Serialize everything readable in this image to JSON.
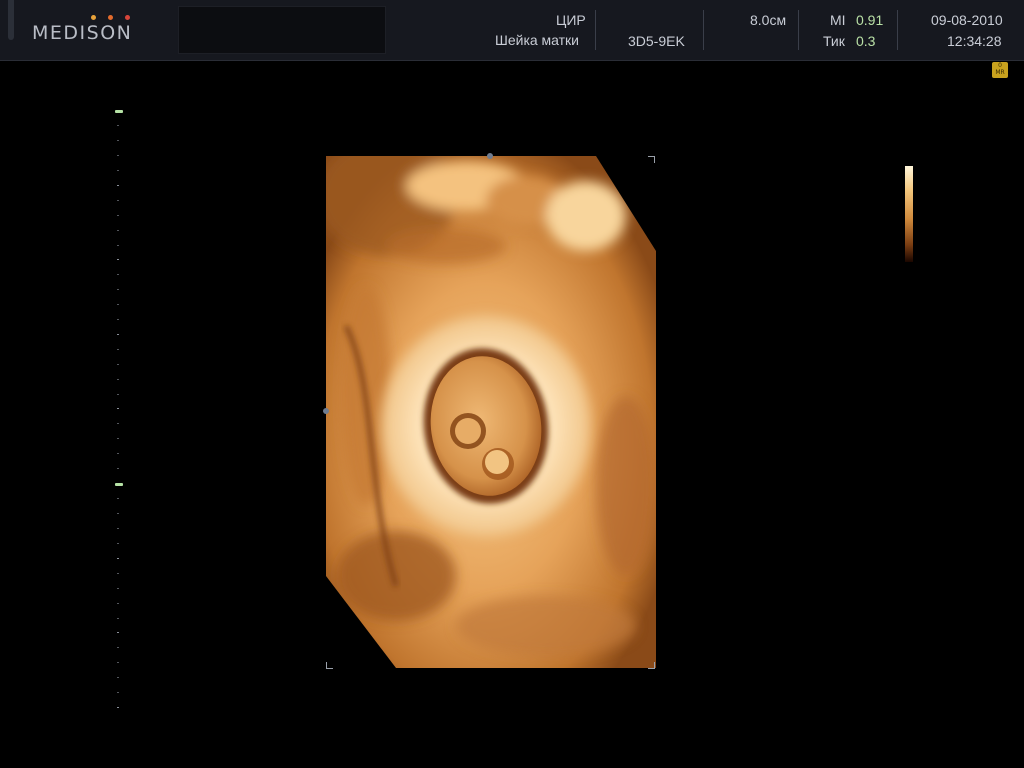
{
  "header": {
    "brand": "MEDISON",
    "mode_label": "ЦИР",
    "organ_label": "Шейка матки",
    "probe": "3D5-9EK",
    "depth": "8.0см",
    "mi_label": "MI",
    "mi_value": "0.91",
    "tic_label": "Тик",
    "tic_value": "0.3",
    "date": "09-08-2010",
    "time": "12:34:28"
  },
  "badges": {
    "mr_icon": "0\nMR"
  },
  "colors": {
    "header_bg": "#16181f",
    "value_green": "#b9e0a6",
    "logo_dot_1": "#e8a23a",
    "logo_dot_2": "#e36b2c",
    "logo_dot_3": "#d8453a",
    "render_tone": "#e0a259"
  },
  "icons": {
    "mr_badge": "mr-icon",
    "colormap": "colormap-bar",
    "depth_scale": "depth-scale"
  }
}
